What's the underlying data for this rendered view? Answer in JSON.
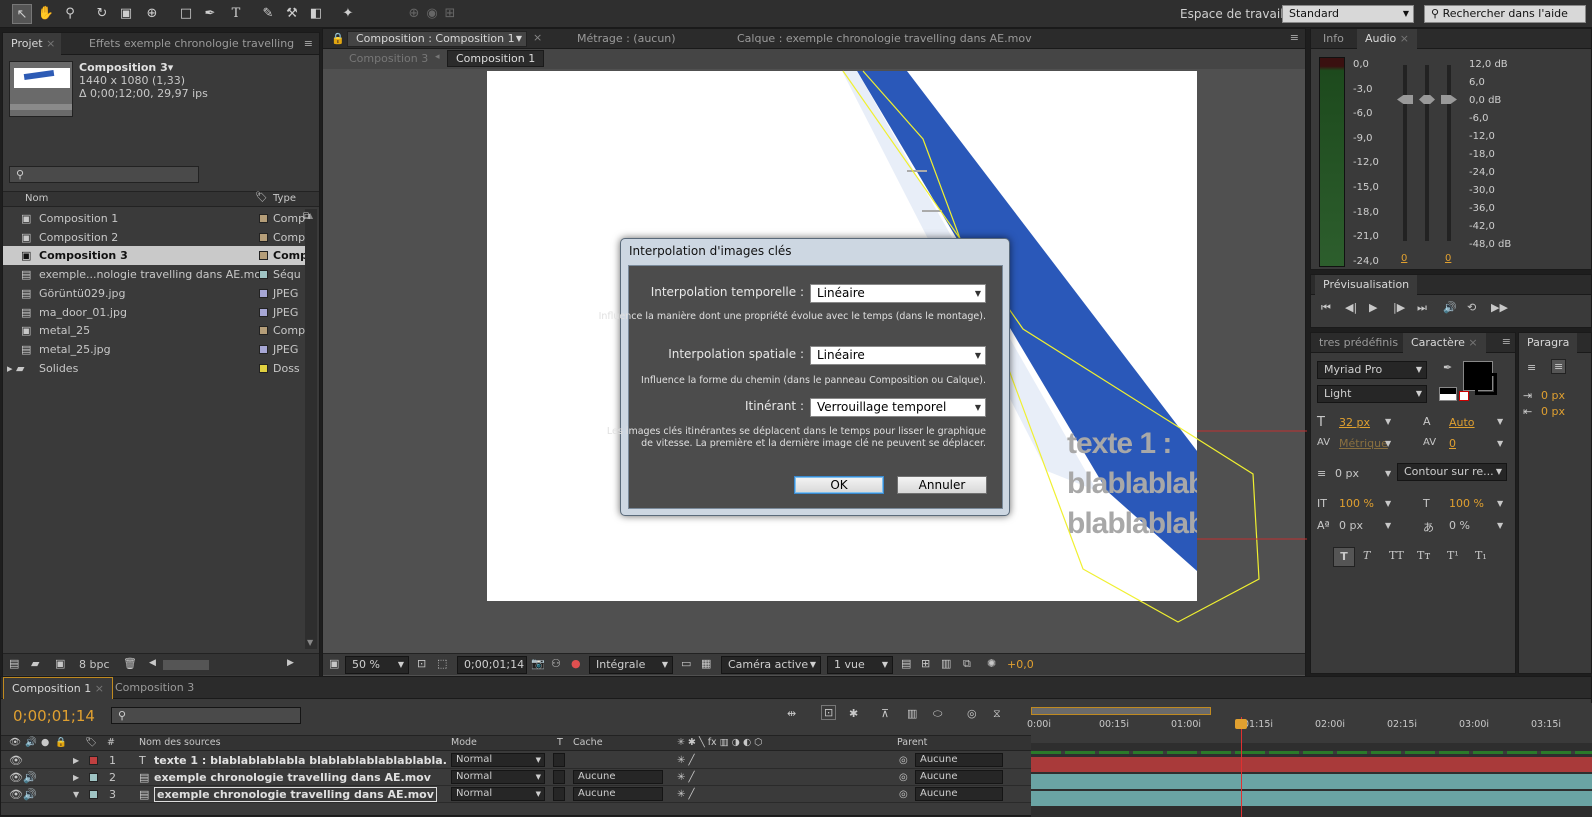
{
  "toolbar": {
    "workspace_label": "Espace de travail :",
    "workspace_value": "Standard",
    "search_placeholder": "Rechercher dans l'aide"
  },
  "project_panel": {
    "tabs": [
      "Projet",
      "Effets exemple chronologie travelling"
    ],
    "comp_name": "Composition 3▾",
    "comp_size": "1440 x 1080 (1,33)",
    "comp_duration": "Δ 0;00;12;00, 29,97 ips",
    "col_name": "Nom",
    "col_type": "Type",
    "items": [
      {
        "name": "Composition 1",
        "type": "Comp",
        "color": "#b59e79"
      },
      {
        "name": "Composition 2",
        "type": "Comp",
        "color": "#b59e79"
      },
      {
        "name": "Composition 3",
        "type": "Comp",
        "color": "#b59e79"
      },
      {
        "name": "exemple...nologie travelling dans AE.mov",
        "type": "Séqu",
        "color": "#9fc4c4"
      },
      {
        "name": "Görüntü029.jpg",
        "type": "JPEG",
        "color": "#a6a6d4"
      },
      {
        "name": "ma_door_01.jpg",
        "type": "JPEG",
        "color": "#a6a6d4"
      },
      {
        "name": "metal_25",
        "type": "Comp",
        "color": "#b59e79"
      },
      {
        "name": "metal_25.jpg",
        "type": "JPEG",
        "color": "#a6a6d4"
      },
      {
        "name": "Solides",
        "type": "Doss",
        "color": "#e0d040"
      }
    ],
    "bpc": "8 bpc"
  },
  "comp_viewer": {
    "tabs": [
      "Composition : Composition 1",
      "Métrage : (aucun)",
      "Calque : exemple chronologie travelling dans AE.mov"
    ],
    "breadcrumb": [
      "Composition 3",
      "Composition 1"
    ],
    "overlay_text": [
      "texte 1 :",
      "blablablabl",
      "blablablabl"
    ],
    "zoom": "50 %",
    "timecode": "0;00;01;14",
    "resolution": "Intégrale",
    "camera": "Caméra active",
    "views": "1 vue",
    "exposure": "+0,0"
  },
  "dialog": {
    "title": "Interpolation d'images clés",
    "temporal_label": "Interpolation temporelle :",
    "temporal_value": "Linéaire",
    "temporal_help": "Influence la manière dont une propriété évolue avec le temps (dans le montage).",
    "spatial_label": "Interpolation spatiale :",
    "spatial_value": "Linéaire",
    "spatial_help": "Influence la forme du chemin (dans le panneau Composition ou Calque).",
    "roving_label": "Itinérant :",
    "roving_value": "Verrouillage temporel",
    "roving_help_1": "Les images clés itinérantes se déplacent dans le temps pour lisser le graphique",
    "roving_help_2": "de vitesse. La première et la dernière image clé ne peuvent se déplacer.",
    "ok": "OK",
    "cancel": "Annuler"
  },
  "audio_panel": {
    "tabs": [
      "Info",
      "Audio"
    ],
    "left_scale": [
      "0,0",
      "-3,0",
      "-6,0",
      "-9,0",
      "-12,0",
      "-15,0",
      "-18,0",
      "-21,0",
      "-24,0"
    ],
    "right_scale": [
      "12,0 dB",
      "6,0",
      "0,0 dB",
      "-6,0",
      "-12,0",
      "-18,0",
      "-24,0",
      "-30,0",
      "-36,0",
      "-42,0",
      "-48,0 dB"
    ],
    "slider_vals": [
      "0",
      "0"
    ]
  },
  "preview_panel": {
    "title": "Prévisualisation"
  },
  "character_panel": {
    "tabs": [
      "tres prédéfinis",
      "Caractère",
      "Paragra"
    ],
    "font": "Myriad Pro",
    "style": "Light",
    "size": "32 px",
    "leading": "Auto",
    "kerning": "Métrique",
    "tracking": "0",
    "stroke": "0 px",
    "stroke_type": "Contour sur re...",
    "vscale": "100 %",
    "hscale": "100 %",
    "baseline": "0 px",
    "tsume": "0 %",
    "para_vals": [
      "0 px",
      "0 px"
    ],
    "color_fill": "#000000"
  },
  "timeline": {
    "tabs": [
      "Composition 1",
      "Composition 3"
    ],
    "timecode": "0;00;01;14",
    "col_headers": {
      "source": "Nom des sources",
      "mode": "Mode",
      "t": "T",
      "cache": "Cache",
      "parent": "Parent"
    },
    "ruler": [
      "0:00i",
      "00:15i",
      "01:00i",
      "01:15i",
      "02:00i",
      "02:15i",
      "03:00i",
      "03:15i"
    ],
    "layers": [
      {
        "num": "1",
        "name": "texte 1 : blablablablabla blablablablablablabla.",
        "mode": "Normal",
        "cache": "",
        "parent": "Aucune",
        "color": "#c04040"
      },
      {
        "num": "2",
        "name": "exemple chronologie travelling dans AE.mov",
        "mode": "Normal",
        "cache": "Aucune",
        "parent": "Aucune",
        "color": "#9fc4c4"
      },
      {
        "num": "3",
        "name": "exemple chronologie travelling dans AE.mov",
        "mode": "Normal",
        "cache": "Aucune",
        "parent": "Aucune",
        "color": "#9fc4c4"
      }
    ]
  }
}
